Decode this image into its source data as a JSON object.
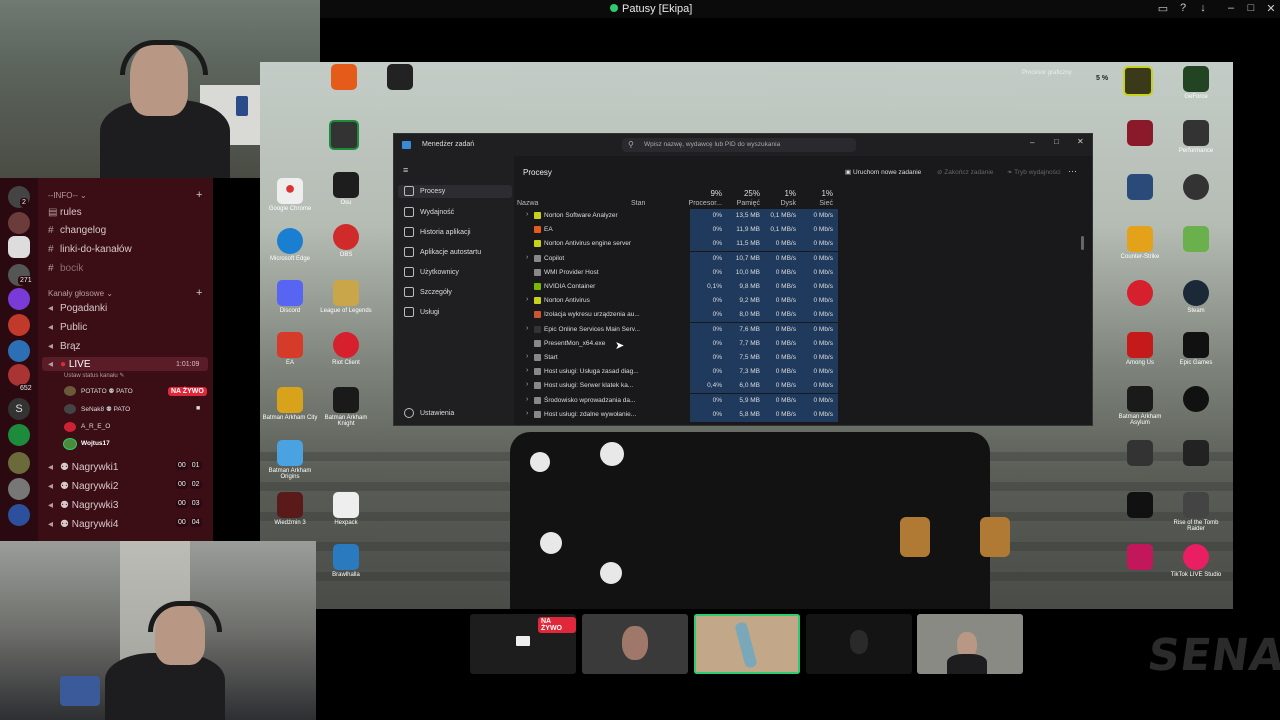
{
  "window": {
    "title": "Patusy [Ekipa]"
  },
  "discord": {
    "categories": [
      {
        "label": "--INFO--",
        "chevron": "chevron-down-icon"
      },
      {
        "label": "Kanały głosowe",
        "chevron": "chevron-down-icon"
      }
    ],
    "text_channels": [
      "rules",
      "changelog",
      "linki-do-kanałów",
      "bocik"
    ],
    "voice_channels": [
      "Pogadanki",
      "Public",
      "Brąz",
      "LIVE"
    ],
    "live": {
      "timer": "1:01:09",
      "status": "Ustaw status kanału"
    },
    "users": [
      {
        "name": "POTATO",
        "tag": "PATO",
        "live": "NA ŻYWO"
      },
      {
        "name": "SeNak8",
        "tag": "PATO"
      },
      {
        "name": "A_R_E_O"
      },
      {
        "name": "Wojtus17"
      }
    ],
    "recording_channels": [
      {
        "label": "Nagrywki1",
        "a": "00",
        "b": "01"
      },
      {
        "label": "Nagrywki2",
        "a": "00",
        "b": "02"
      },
      {
        "label": "Nagrywki3",
        "a": "00",
        "b": "03"
      },
      {
        "label": "Nagrywki4",
        "a": "00",
        "b": "04"
      }
    ],
    "server_badges": [
      "2",
      "271",
      "652"
    ]
  },
  "desktop": {
    "icons_left": [
      "Google Chrome",
      "Microsoft Edge",
      "Discord",
      "EA",
      "Batman Arkham City",
      "Batman Arkham Origins",
      "Wiedźmin 3",
      "Brawlhalla"
    ],
    "icons_col2": [
      "Osu",
      "OBS",
      "League of Legends",
      "Riot Client",
      "Batman Arkham Knight",
      "Hexpack"
    ],
    "icons_right": [
      "GeForce",
      "Performance",
      "Counter-Strike",
      "Steam",
      "Epic Games",
      "Among Us",
      "Batman Arkham Asylum",
      "Rise of the Tomb Raider",
      "TikTok LIVE Studio"
    ],
    "tray": {
      "cpu_label": "Procesor graficzny",
      "pct": "5 %"
    }
  },
  "taskmgr": {
    "app_title": "Menedżer zadań",
    "search_placeholder": "Wpisz nazwę, wydawcę lub PID do wyszukania",
    "nav": [
      "Procesy",
      "Wydajność",
      "Historia aplikacji",
      "Aplikacje autostartu",
      "Użytkownicy",
      "Szczegóły",
      "Usługi"
    ],
    "settings": "Ustawienia",
    "section": "Procesy",
    "actions": [
      "Uruchom nowe zadanie",
      "Zakończ zadanie",
      "Tryb wydajności"
    ],
    "columns": {
      "name": "Nazwa",
      "status": "Stan",
      "cpu_pct": "9%",
      "cpu": "Procesor...",
      "mem_pct": "25%",
      "mem": "Pamięć",
      "disk_pct": "1%",
      "disk": "Dysk",
      "net_pct": "1%",
      "net": "Sieć"
    },
    "rows": [
      {
        "name": "Norton Software Analyzer",
        "cpu": "0%",
        "mem": "13,5 MB",
        "disk": "0,1 MB/s",
        "net": "0 Mb/s"
      },
      {
        "name": "EA",
        "cpu": "0%",
        "mem": "11,9 MB",
        "disk": "0,1 MB/s",
        "net": "0 Mb/s"
      },
      {
        "name": "Norton Antivirus engine server",
        "cpu": "0%",
        "mem": "11,5 MB",
        "disk": "0 MB/s",
        "net": "0 Mb/s"
      },
      {
        "name": "Copilot",
        "cpu": "0%",
        "mem": "10,7 MB",
        "disk": "0 MB/s",
        "net": "0 Mb/s"
      },
      {
        "name": "WMI Provider Host",
        "cpu": "0%",
        "mem": "10,0 MB",
        "disk": "0 MB/s",
        "net": "0 Mb/s"
      },
      {
        "name": "NVIDIA Container",
        "cpu": "0,1%",
        "mem": "9,8 MB",
        "disk": "0 MB/s",
        "net": "0 Mb/s"
      },
      {
        "name": "Norton Antivirus",
        "cpu": "0%",
        "mem": "9,2 MB",
        "disk": "0 MB/s",
        "net": "0 Mb/s"
      },
      {
        "name": "Izolacja wykresu urządzenia au...",
        "cpu": "0%",
        "mem": "8,0 MB",
        "disk": "0 MB/s",
        "net": "0 Mb/s"
      },
      {
        "name": "Epic Online Services Main Serv...",
        "cpu": "0%",
        "mem": "7,6 MB",
        "disk": "0 MB/s",
        "net": "0 Mb/s"
      },
      {
        "name": "PresentMon_x64.exe",
        "cpu": "0%",
        "mem": "7,7 MB",
        "disk": "0 MB/s",
        "net": "0 Mb/s"
      },
      {
        "name": "Start",
        "cpu": "0%",
        "mem": "7,5 MB",
        "disk": "0 MB/s",
        "net": "0 Mb/s"
      },
      {
        "name": "Host usługi: Usługa zasad diag...",
        "cpu": "0%",
        "mem": "7,3 MB",
        "disk": "0 MB/s",
        "net": "0 Mb/s"
      },
      {
        "name": "Host usługi: Serwer klatek ka...",
        "cpu": "0,4%",
        "mem": "6,0 MB",
        "disk": "0 MB/s",
        "net": "0 Mb/s"
      },
      {
        "name": "Środowisko wprowadzania da...",
        "cpu": "0%",
        "mem": "5,9 MB",
        "disk": "0 MB/s",
        "net": "0 Mb/s"
      },
      {
        "name": "Host usługi: zdalne wywołanie...",
        "cpu": "0%",
        "mem": "5,8 MB",
        "disk": "0 MB/s",
        "net": "0 Mb/s"
      }
    ]
  },
  "thumbnails": {
    "live_label": "NA ŻYWO"
  },
  "watermark": "SENAK",
  "colors": {
    "discord_bg": "#3b0e16",
    "live_red": "#e0283a",
    "tm_highlight": "#1f3a5c",
    "accent_green": "#2ecc71"
  }
}
